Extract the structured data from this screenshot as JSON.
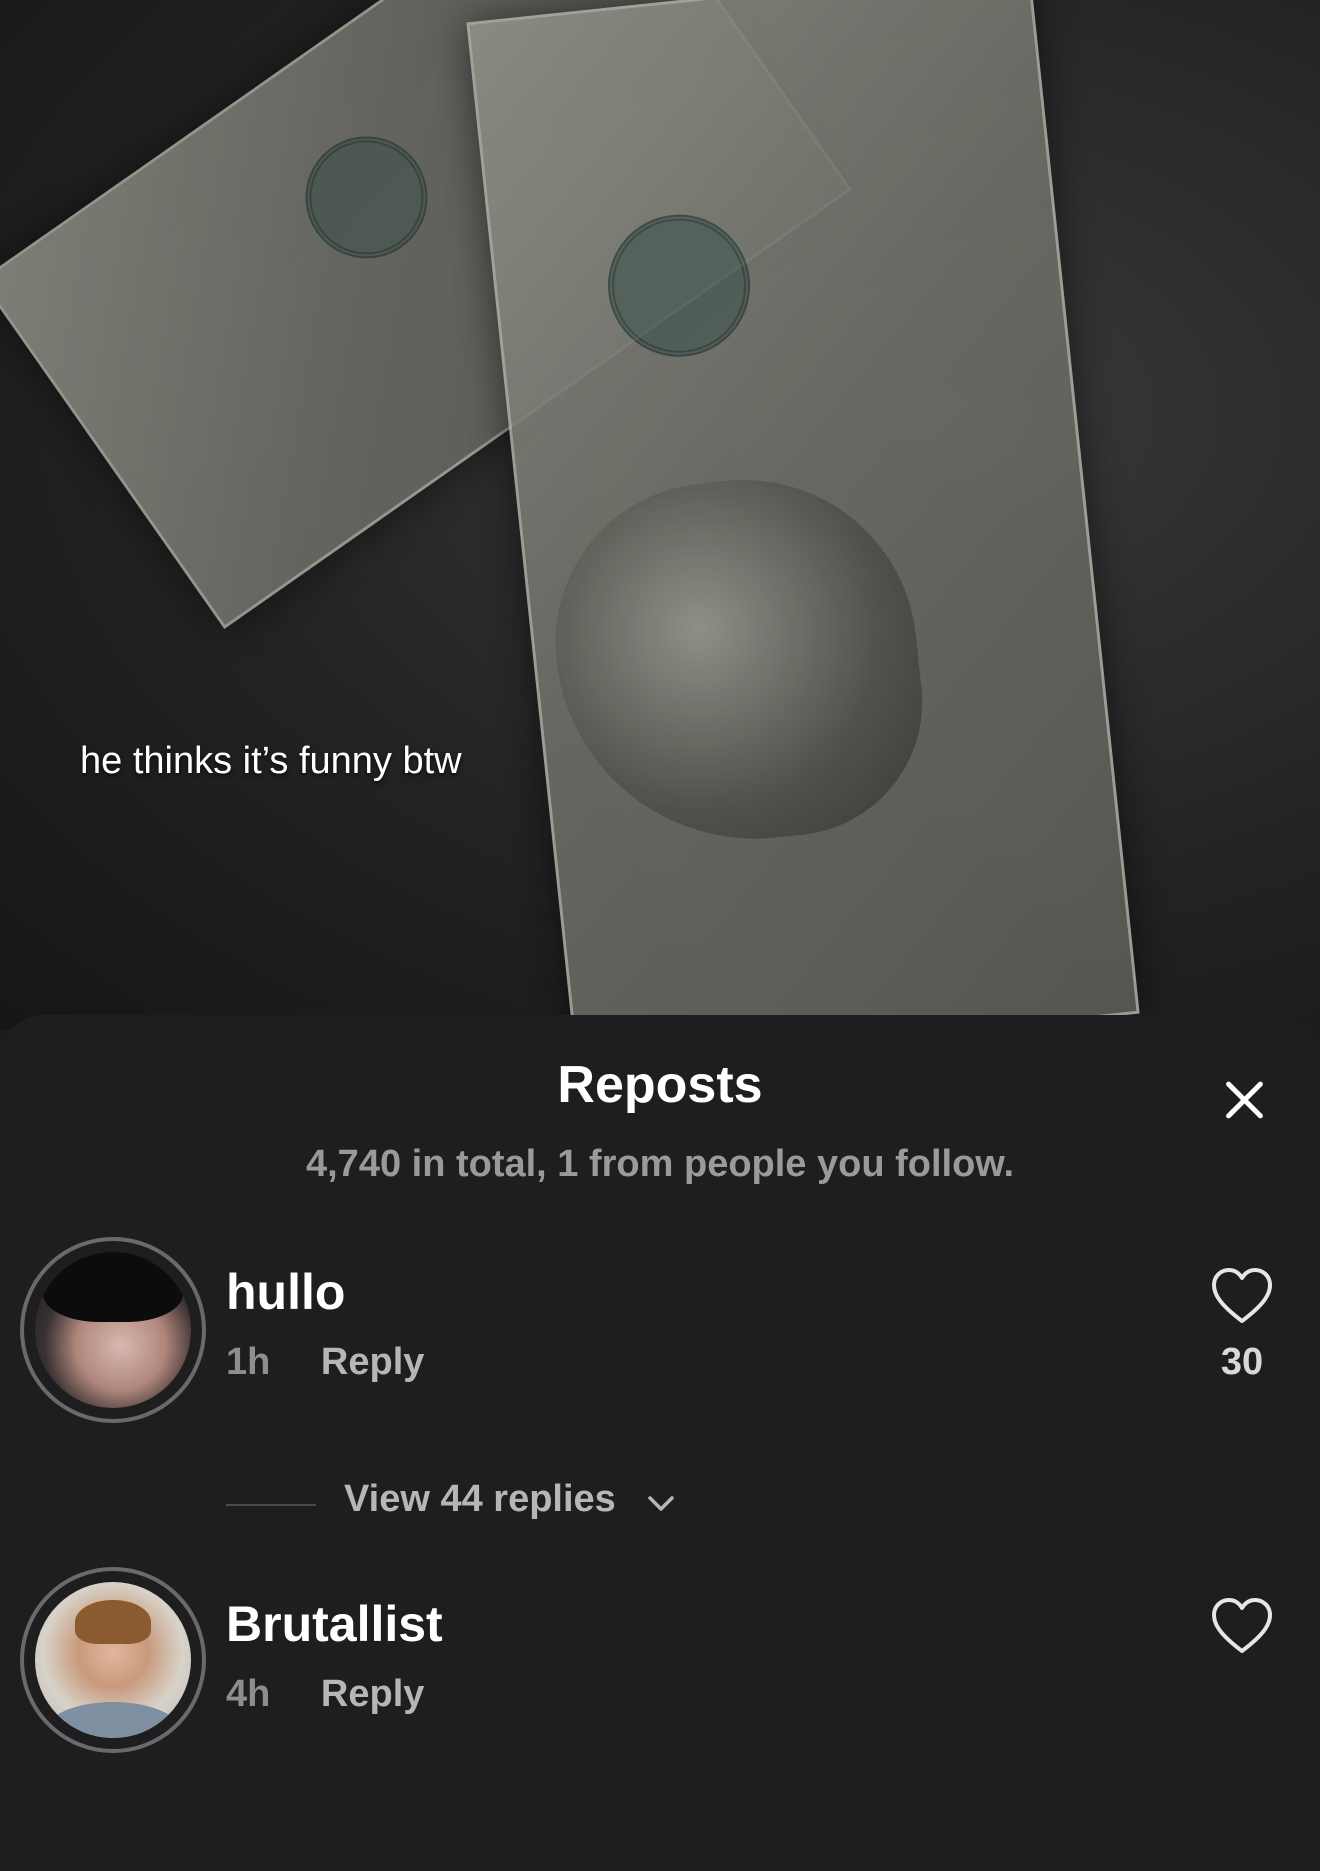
{
  "video": {
    "caption": "he thinks it’s funny btw"
  },
  "sheet": {
    "title": "Reposts",
    "subtitle": "4,740 in total, 1 from people you follow."
  },
  "comments": [
    {
      "username": "hullo",
      "time": "1h",
      "reply_label": "Reply",
      "likes": "30",
      "view_replies": "View 44 replies"
    },
    {
      "username": "Brutallist",
      "time": "4h",
      "reply_label": "Reply",
      "likes": ""
    }
  ],
  "colors": {
    "sheet_bg": "#1e1e20",
    "muted_text": "#9a9a9c"
  },
  "icons": {
    "close": "close-icon",
    "like": "heart-icon",
    "expand": "chevron-down-icon"
  }
}
